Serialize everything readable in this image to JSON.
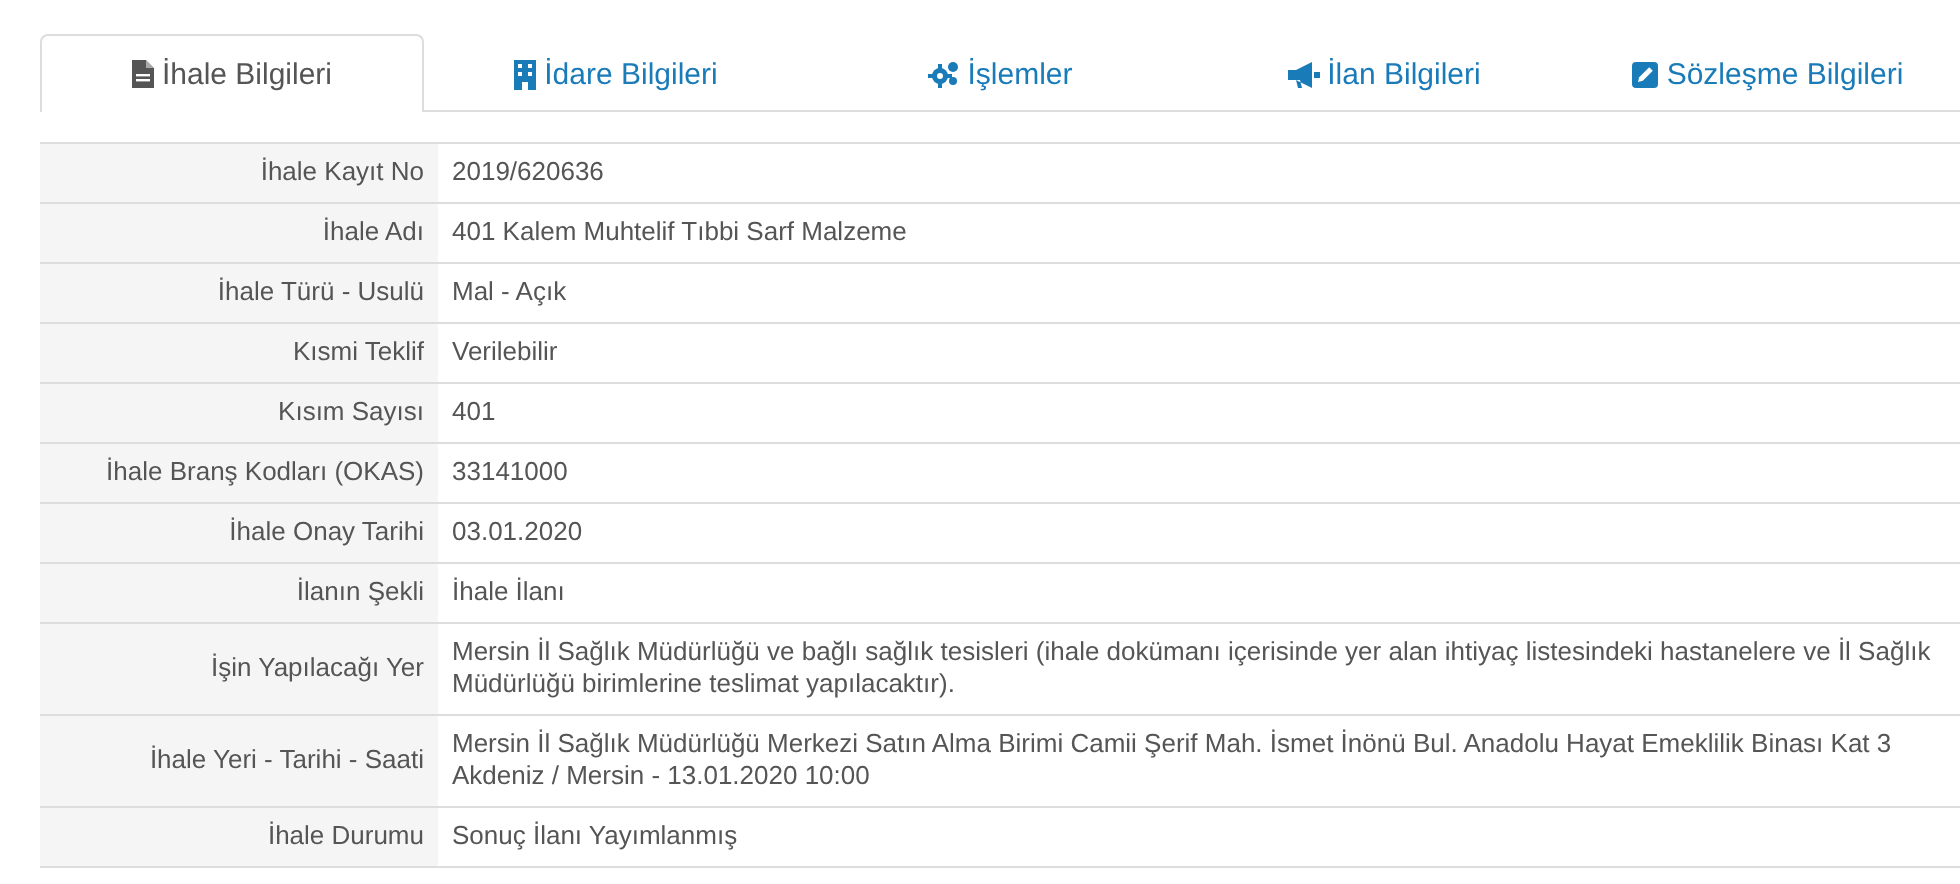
{
  "tabs": [
    {
      "label": "İhale Bilgileri",
      "selected": true
    },
    {
      "label": "İdare Bilgileri",
      "selected": false
    },
    {
      "label": "İşlemler",
      "selected": false
    },
    {
      "label": "İlan Bilgileri",
      "selected": false
    },
    {
      "label": "Sözleşme Bilgileri",
      "selected": false
    }
  ],
  "details": [
    {
      "label": "İhale Kayıt No",
      "value": "2019/620636"
    },
    {
      "label": "İhale Adı",
      "value": "401 Kalem Muhtelif Tıbbi Sarf Malzeme"
    },
    {
      "label": "İhale Türü - Usulü",
      "value": "Mal - Açık"
    },
    {
      "label": "Kısmi Teklif",
      "value": "Verilebilir"
    },
    {
      "label": "Kısım Sayısı",
      "value": "401"
    },
    {
      "label": "İhale Branş Kodları (OKAS)",
      "value": "33141000"
    },
    {
      "label": "İhale Onay Tarihi",
      "value": "03.01.2020"
    },
    {
      "label": "İlanın Şekli",
      "value": "İhale İlanı"
    },
    {
      "label": "İşin Yapılacağı Yer",
      "value": "Mersin İl Sağlık Müdürlüğü ve bağlı sağlık tesisleri (ihale dokümanı içerisinde yer alan ihtiyaç listesindeki hastanelere ve İl Sağlık Müdürlüğü birimlerine teslimat yapılacaktır)."
    },
    {
      "label": "İhale Yeri - Tarihi - Saati",
      "value": "Mersin İl Sağlık Müdürlüğü Merkezi Satın Alma Birimi Camii Şerif Mah. İsmet İnönü Bul. Anadolu Hayat Emeklilik Binası Kat 3 Akdeniz / Mersin - 13.01.2020 10:00"
    },
    {
      "label": "İhale Durumu",
      "value": "Sonuç İlanı Yayımlanmış"
    }
  ]
}
